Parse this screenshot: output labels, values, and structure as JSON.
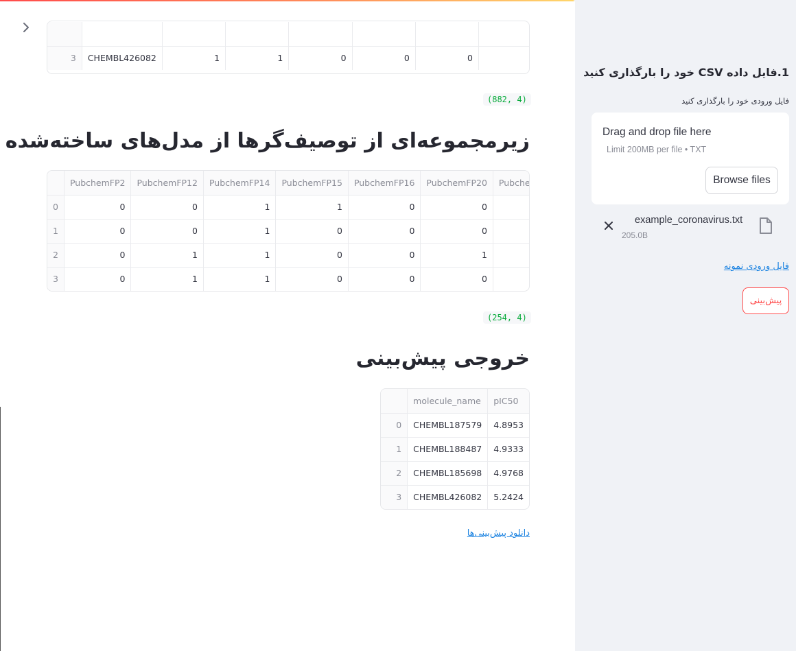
{
  "main": {
    "table1": {
      "row": [
        "3",
        "CHEMBL426082",
        "1",
        "1",
        "0",
        "0",
        "0",
        ""
      ]
    },
    "shape1": "(882, 4)",
    "heading_descriptors": "زیرمجموعه‌ای از توصیف‌گرها از مدل‌های ساخته‌شده قبلی",
    "table2": {
      "columns": [
        "",
        "PubchemFP2",
        "PubchemFP12",
        "PubchemFP14",
        "PubchemFP15",
        "PubchemFP16",
        "PubchemFP20",
        "Pubche"
      ],
      "rows": [
        [
          "0",
          "0",
          "0",
          "1",
          "1",
          "0",
          "0",
          ""
        ],
        [
          "1",
          "0",
          "0",
          "1",
          "0",
          "0",
          "0",
          ""
        ],
        [
          "2",
          "0",
          "1",
          "1",
          "0",
          "0",
          "1",
          ""
        ],
        [
          "3",
          "0",
          "1",
          "1",
          "0",
          "0",
          "0",
          ""
        ]
      ]
    },
    "shape2": "(254, 4)",
    "heading_output": "خروجی پیش‌بینی",
    "table3": {
      "columns": [
        "",
        "molecule_name",
        "pIC50"
      ],
      "rows": [
        [
          "0",
          "CHEMBL187579",
          "4.8953"
        ],
        [
          "1",
          "CHEMBL188487",
          "4.9333"
        ],
        [
          "2",
          "CHEMBL185698",
          "4.9768"
        ],
        [
          "3",
          "CHEMBL426082",
          "5.2424"
        ]
      ]
    },
    "download_link": "دانلود پیش‌بینی‌ها"
  },
  "sidebar": {
    "heading": "1.فایل داده CSV خود را بارگذاری کنید",
    "upload_label": "فایل ورودی خود را بارگذاری کنید",
    "dropzone_title": "Drag and drop file here",
    "dropzone_limit": "Limit 200MB per file • TXT",
    "browse_label": "Browse files",
    "file_name": "example_coronavirus.txt",
    "file_size": "205.0B",
    "sample_link": "فایل ورودی نمونه",
    "predict_label": "پیش‌بینی"
  },
  "colors": {
    "accent": "#ff4b4b",
    "link": "#1c83e1",
    "tuple_green": "#09ab3b",
    "sidebar_bg": "#f0f2f6"
  },
  "icons": [
    "chevron-right-icon",
    "close-icon",
    "file-icon"
  ]
}
